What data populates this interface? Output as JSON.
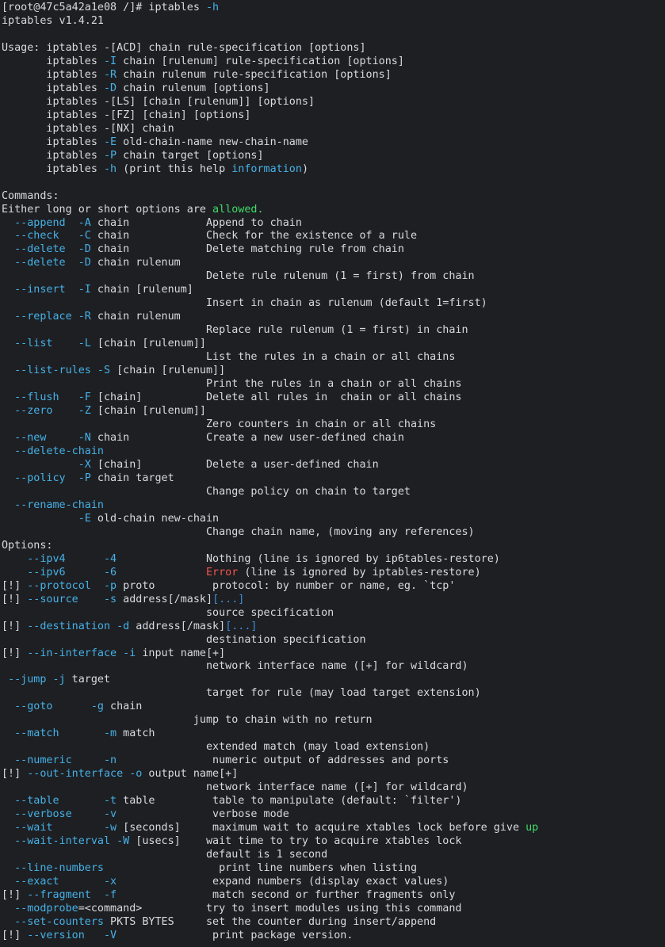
{
  "colors": {
    "background": "#1e1f22",
    "text": "#d7dae0",
    "flag": "#45b1e8",
    "highlight": "#3fdc6a",
    "error": "#ef5350",
    "link": "#3b8edc"
  },
  "lines": [
    [
      {
        "t": "[root@47c5a42a1e08 /]# iptables "
      },
      {
        "t": "-h",
        "c": "cyan"
      }
    ],
    [
      {
        "t": "iptables v1.4.21"
      }
    ],
    [
      {
        "t": ""
      }
    ],
    [
      {
        "t": "Usage: iptables -[ACD] chain rule-specification [options]"
      }
    ],
    [
      {
        "t": "       iptables "
      },
      {
        "t": "-I",
        "c": "cyan"
      },
      {
        "t": " chain [rulenum] rule-specification [options]"
      }
    ],
    [
      {
        "t": "       iptables "
      },
      {
        "t": "-R",
        "c": "cyan"
      },
      {
        "t": " chain rulenum rule-specification [options]"
      }
    ],
    [
      {
        "t": "       iptables "
      },
      {
        "t": "-D",
        "c": "cyan"
      },
      {
        "t": " chain rulenum [options]"
      }
    ],
    [
      {
        "t": "       iptables -[LS] [chain [rulenum]] [options]"
      }
    ],
    [
      {
        "t": "       iptables -[FZ] [chain] [options]"
      }
    ],
    [
      {
        "t": "       iptables -[NX] chain"
      }
    ],
    [
      {
        "t": "       iptables "
      },
      {
        "t": "-E",
        "c": "cyan"
      },
      {
        "t": " old-chain-name new-chain-name"
      }
    ],
    [
      {
        "t": "       iptables "
      },
      {
        "t": "-P",
        "c": "cyan"
      },
      {
        "t": " chain target [options]"
      }
    ],
    [
      {
        "t": "       iptables "
      },
      {
        "t": "-h",
        "c": "cyan"
      },
      {
        "t": " (print this help "
      },
      {
        "t": "information",
        "c": "cyan"
      },
      {
        "t": ")"
      }
    ],
    [
      {
        "t": ""
      }
    ],
    [
      {
        "t": "Commands:"
      }
    ],
    [
      {
        "t": "Either long or short options are "
      },
      {
        "t": "allowed.",
        "c": "green"
      }
    ],
    [
      {
        "t": "  "
      },
      {
        "t": "--append  -A",
        "c": "cyan"
      },
      {
        "t": " chain            Append to chain"
      }
    ],
    [
      {
        "t": "  "
      },
      {
        "t": "--check   -C",
        "c": "cyan"
      },
      {
        "t": " chain            Check for the existence of a rule"
      }
    ],
    [
      {
        "t": "  "
      },
      {
        "t": "--delete  -D",
        "c": "cyan"
      },
      {
        "t": " chain            Delete matching rule from chain"
      }
    ],
    [
      {
        "t": "  "
      },
      {
        "t": "--delete  -D",
        "c": "cyan"
      },
      {
        "t": " chain rulenum"
      }
    ],
    [
      {
        "t": "                                Delete rule rulenum (1 = first) from chain"
      }
    ],
    [
      {
        "t": "  "
      },
      {
        "t": "--insert  -I",
        "c": "cyan"
      },
      {
        "t": " chain [rulenum]"
      }
    ],
    [
      {
        "t": "                                Insert in chain as rulenum (default 1=first)"
      }
    ],
    [
      {
        "t": "  "
      },
      {
        "t": "--replace -R",
        "c": "cyan"
      },
      {
        "t": " chain rulenum"
      }
    ],
    [
      {
        "t": "                                Replace rule rulenum (1 = first) in chain"
      }
    ],
    [
      {
        "t": "  "
      },
      {
        "t": "--list    -L",
        "c": "cyan"
      },
      {
        "t": " [chain [rulenum]]"
      }
    ],
    [
      {
        "t": "                                List the rules in a chain or all chains"
      }
    ],
    [
      {
        "t": "  "
      },
      {
        "t": "--list-rules -S",
        "c": "cyan"
      },
      {
        "t": " [chain [rulenum]]"
      }
    ],
    [
      {
        "t": "                                Print the rules in a chain or all chains"
      }
    ],
    [
      {
        "t": "  "
      },
      {
        "t": "--flush   -F",
        "c": "cyan"
      },
      {
        "t": " [chain]          Delete all rules in  chain or all chains"
      }
    ],
    [
      {
        "t": "  "
      },
      {
        "t": "--zero    -Z",
        "c": "cyan"
      },
      {
        "t": " [chain [rulenum]]"
      }
    ],
    [
      {
        "t": "                                Zero counters in chain or all chains"
      }
    ],
    [
      {
        "t": "  "
      },
      {
        "t": "--new     -N",
        "c": "cyan"
      },
      {
        "t": " chain            Create a new user-defined chain"
      }
    ],
    [
      {
        "t": "  "
      },
      {
        "t": "--delete-chain",
        "c": "cyan"
      }
    ],
    [
      {
        "t": "            "
      },
      {
        "t": "-X",
        "c": "cyan"
      },
      {
        "t": " [chain]          Delete a user-defined chain"
      }
    ],
    [
      {
        "t": "  "
      },
      {
        "t": "--policy  -P",
        "c": "cyan"
      },
      {
        "t": " chain target"
      }
    ],
    [
      {
        "t": "                                Change policy on chain to target"
      }
    ],
    [
      {
        "t": "  "
      },
      {
        "t": "--rename-chain",
        "c": "cyan"
      }
    ],
    [
      {
        "t": "            "
      },
      {
        "t": "-E",
        "c": "cyan"
      },
      {
        "t": " old-chain new-chain"
      }
    ],
    [
      {
        "t": "                                Change chain name, (moving any references)"
      }
    ],
    [
      {
        "t": "Options:"
      }
    ],
    [
      {
        "t": "    "
      },
      {
        "t": "--ipv4      -4",
        "c": "cyan"
      },
      {
        "t": "              Nothing (line is ignored by ip6tables-restore)"
      }
    ],
    [
      {
        "t": "    "
      },
      {
        "t": "--ipv6      -6",
        "c": "cyan"
      },
      {
        "t": "              "
      },
      {
        "t": "Error",
        "c": "red"
      },
      {
        "t": " (line is ignored by iptables-restore)"
      }
    ],
    [
      {
        "t": "[!] "
      },
      {
        "t": "--protocol  -p",
        "c": "cyan"
      },
      {
        "t": " proto         protocol: by number or name, eg. `tcp'"
      }
    ],
    [
      {
        "t": "[!] "
      },
      {
        "t": "--source    -s",
        "c": "cyan"
      },
      {
        "t": " address[/mask]"
      },
      {
        "t": "[...]",
        "c": "blue"
      }
    ],
    [
      {
        "t": "                                source specification"
      }
    ],
    [
      {
        "t": "[!] "
      },
      {
        "t": "--destination -d",
        "c": "cyan"
      },
      {
        "t": " address[/mask]"
      },
      {
        "t": "[...]",
        "c": "blue"
      }
    ],
    [
      {
        "t": "                                destination specification"
      }
    ],
    [
      {
        "t": "[!] "
      },
      {
        "t": "--in-interface -i",
        "c": "cyan"
      },
      {
        "t": " input name[+]"
      }
    ],
    [
      {
        "t": "                                network interface name ([+] for wildcard)"
      }
    ],
    [
      {
        "t": " "
      },
      {
        "t": "--jump -j",
        "c": "cyan"
      },
      {
        "t": " target"
      }
    ],
    [
      {
        "t": "                                target for rule (may load target extension)"
      }
    ],
    [
      {
        "t": "  "
      },
      {
        "t": "--goto      -g",
        "c": "cyan"
      },
      {
        "t": " chain"
      }
    ],
    [
      {
        "t": "                              jump to chain with no return"
      }
    ],
    [
      {
        "t": "  "
      },
      {
        "t": "--match       -m",
        "c": "cyan"
      },
      {
        "t": " match"
      }
    ],
    [
      {
        "t": "                                extended match (may load extension)"
      }
    ],
    [
      {
        "t": "  "
      },
      {
        "t": "--numeric     -n",
        "c": "cyan"
      },
      {
        "t": "               numeric output of addresses and ports"
      }
    ],
    [
      {
        "t": "[!] "
      },
      {
        "t": "--out-interface -o",
        "c": "cyan"
      },
      {
        "t": " output name[+]"
      }
    ],
    [
      {
        "t": "                                network interface name ([+] for wildcard)"
      }
    ],
    [
      {
        "t": "  "
      },
      {
        "t": "--table       -t",
        "c": "cyan"
      },
      {
        "t": " table         table to manipulate (default: `filter')"
      }
    ],
    [
      {
        "t": "  "
      },
      {
        "t": "--verbose     -v",
        "c": "cyan"
      },
      {
        "t": "               verbose mode"
      }
    ],
    [
      {
        "t": "  "
      },
      {
        "t": "--wait        -w",
        "c": "cyan"
      },
      {
        "t": " [seconds]     maximum wait to acquire xtables lock before give "
      },
      {
        "t": "up",
        "c": "green"
      }
    ],
    [
      {
        "t": "  "
      },
      {
        "t": "--wait-interval -W",
        "c": "cyan"
      },
      {
        "t": " [usecs]    wait time to try to acquire xtables lock"
      }
    ],
    [
      {
        "t": "                                default is 1 second"
      }
    ],
    [
      {
        "t": "  "
      },
      {
        "t": "--line-numbers",
        "c": "cyan"
      },
      {
        "t": "                  print line numbers when listing"
      }
    ],
    [
      {
        "t": "  "
      },
      {
        "t": "--exact       -x",
        "c": "cyan"
      },
      {
        "t": "               expand numbers (display exact values)"
      }
    ],
    [
      {
        "t": "[!] "
      },
      {
        "t": "--fragment  -f",
        "c": "cyan"
      },
      {
        "t": "               match second or further fragments only"
      }
    ],
    [
      {
        "t": "  "
      },
      {
        "t": "--modprobe",
        "c": "cyan"
      },
      {
        "t": "=<command>          try to insert modules using this command"
      }
    ],
    [
      {
        "t": "  "
      },
      {
        "t": "--set-counters",
        "c": "cyan"
      },
      {
        "t": " PKTS BYTES     set the counter during insert/append"
      }
    ],
    [
      {
        "t": "[!] "
      },
      {
        "t": "--version   -V",
        "c": "cyan"
      },
      {
        "t": "               print package version."
      }
    ]
  ]
}
